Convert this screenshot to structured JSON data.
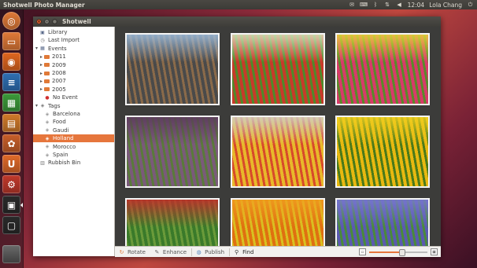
{
  "top_panel": {
    "app_title": "Shotwell Photo Manager",
    "clock": "12:04",
    "user": "Lola Chang",
    "icons": [
      "mail-icon",
      "keyboard-icon",
      "bluetooth-icon",
      "network-icon",
      "volume-icon",
      "power-icon"
    ]
  },
  "launcher": {
    "items": [
      {
        "name": "dash-home",
        "color": "#e07a38"
      },
      {
        "name": "files",
        "color": "#e07a38"
      },
      {
        "name": "firefox",
        "color": "#e0661f"
      },
      {
        "name": "writer",
        "color": "#2f6fb3"
      },
      {
        "name": "calc",
        "color": "#3c9a3a"
      },
      {
        "name": "impress",
        "color": "#d07a2a"
      },
      {
        "name": "shotwell",
        "color": "#c85f2a"
      },
      {
        "name": "ubuntu-one",
        "color": "#e06a2a"
      },
      {
        "name": "settings",
        "color": "#c0392b"
      },
      {
        "name": "shotwell-active",
        "color": "#2a2a2a"
      },
      {
        "name": "workspaces",
        "color": "#2a2a2a"
      }
    ]
  },
  "window": {
    "title": "Shotwell"
  },
  "sidebar": {
    "items": [
      {
        "label": "Library",
        "level": 0,
        "icon": "library-icon",
        "arrow": ""
      },
      {
        "label": "Last Import",
        "level": 0,
        "icon": "import-icon",
        "arrow": ""
      },
      {
        "label": "Events",
        "level": 0,
        "icon": "events-icon",
        "arrow": "▾"
      },
      {
        "label": "2011",
        "level": 1,
        "icon": "folder-icon",
        "arrow": "▸"
      },
      {
        "label": "2009",
        "level": 1,
        "icon": "folder-icon",
        "arrow": "▸"
      },
      {
        "label": "2008",
        "level": 1,
        "icon": "folder-icon",
        "arrow": "▸"
      },
      {
        "label": "2007",
        "level": 1,
        "icon": "folder-icon",
        "arrow": "▸"
      },
      {
        "label": "2005",
        "level": 1,
        "icon": "folder-icon",
        "arrow": "▸"
      },
      {
        "label": "No Event",
        "level": 1,
        "icon": "no-event-icon",
        "arrow": ""
      },
      {
        "label": "Tags",
        "level": 0,
        "icon": "tags-icon",
        "arrow": "▾"
      },
      {
        "label": "Barcelona",
        "level": 1,
        "icon": "tag-icon",
        "arrow": ""
      },
      {
        "label": "Food",
        "level": 1,
        "icon": "tag-icon",
        "arrow": ""
      },
      {
        "label": "Gaudi",
        "level": 1,
        "icon": "tag-icon",
        "arrow": ""
      },
      {
        "label": "Holland",
        "level": 1,
        "icon": "tag-icon",
        "arrow": "",
        "selected": true
      },
      {
        "label": "Morocco",
        "level": 1,
        "icon": "tag-icon",
        "arrow": ""
      },
      {
        "label": "Spain",
        "level": 1,
        "icon": "tag-icon",
        "arrow": ""
      },
      {
        "label": "Rubbish Bin",
        "level": 0,
        "icon": "trash-icon",
        "arrow": ""
      }
    ]
  },
  "photos": [
    {
      "subject": "harbor-houses",
      "colors": [
        "#9fbfe0",
        "#4a4a4a",
        "#8a6a4a"
      ]
    },
    {
      "subject": "red-tulip-field",
      "colors": [
        "#d9e6c0",
        "#c83a2a",
        "#4f8a2a"
      ]
    },
    {
      "subject": "yellow-pink-tulips",
      "colors": [
        "#e8d83a",
        "#d83a6a",
        "#5a8a2a"
      ]
    },
    {
      "subject": "purple-tulips",
      "colors": [
        "#5a3a5a",
        "#7a5a7a",
        "#5a7a3a"
      ]
    },
    {
      "subject": "tulip-field-stripes",
      "colors": [
        "#d0d0c8",
        "#e8b82a",
        "#d84a2a"
      ]
    },
    {
      "subject": "yellow-tulips-closeup",
      "colors": [
        "#f0d020",
        "#e8b810",
        "#4a7a1a"
      ]
    },
    {
      "subject": "red-tulip-closeup",
      "colors": [
        "#c82a2a",
        "#3a7a2a",
        "#6a9a3a"
      ]
    },
    {
      "subject": "orange-tulips",
      "colors": [
        "#f0a020",
        "#e07010",
        "#d8c020"
      ]
    },
    {
      "subject": "blue-hyacinths",
      "colors": [
        "#7a7ad0",
        "#5a5ab0",
        "#4a8a3a"
      ]
    }
  ],
  "statusbar": {
    "rotate_label": "Rotate",
    "enhance_label": "Enhance",
    "publish_label": "Publish",
    "find_label": "Find",
    "zoom_level": 0.55
  }
}
